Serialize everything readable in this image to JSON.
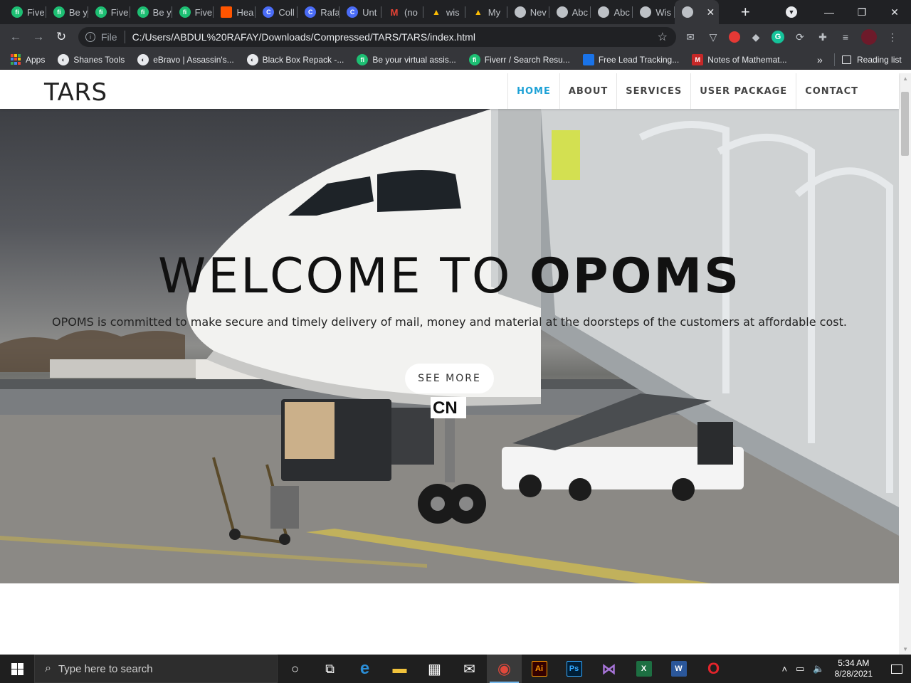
{
  "browser": {
    "tabs": [
      {
        "label": "Five",
        "icon": "fiverr-icon",
        "badge": "fi"
      },
      {
        "label": "Be y",
        "icon": "fiverr-icon",
        "badge": "fi"
      },
      {
        "label": "Five",
        "icon": "fiverr-icon",
        "badge": "fi"
      },
      {
        "label": "Be y",
        "icon": "fiverr-icon",
        "badge": "fi"
      },
      {
        "label": "Five",
        "icon": "fiverr-icon",
        "badge": "fi"
      },
      {
        "label": "Hea",
        "icon": "soundcloud-icon",
        "badge": ""
      },
      {
        "label": "Coll",
        "icon": "c-icon",
        "badge": "C"
      },
      {
        "label": "Rafa",
        "icon": "c-icon",
        "badge": "C"
      },
      {
        "label": "Unt",
        "icon": "c-icon",
        "badge": "C"
      },
      {
        "label": "(no",
        "icon": "gmail-icon",
        "badge": "M"
      },
      {
        "label": "wis",
        "icon": "drive-icon",
        "badge": "▲"
      },
      {
        "label": "My",
        "icon": "drive-icon",
        "badge": "▲"
      },
      {
        "label": "Nev",
        "icon": "chrome-icon",
        "badge": ""
      },
      {
        "label": "Abc",
        "icon": "globe-icon",
        "badge": ""
      },
      {
        "label": "Abc",
        "icon": "globe-icon",
        "badge": ""
      },
      {
        "label": "Wis",
        "icon": "globe-icon",
        "badge": ""
      }
    ],
    "active_tab_close": "✕",
    "new_tab": "+",
    "address": {
      "scheme_label": "File",
      "url": "C:/Users/ABDUL%20RAFAY/Downloads/Compressed/TARS/TARS/index.html"
    },
    "bookmarks": [
      {
        "label": "Apps",
        "icon": "apps-icon"
      },
      {
        "label": "Shanes Tools",
        "icon": "globe-icon"
      },
      {
        "label": "eBravo | Assassin's...",
        "icon": "globe-icon"
      },
      {
        "label": "Black Box Repack -...",
        "icon": "globe-icon"
      },
      {
        "label": "Be your virtual assis...",
        "icon": "fiverr-icon"
      },
      {
        "label": "Fiverr / Search Resu...",
        "icon": "fiverr-icon"
      },
      {
        "label": "Free Lead Tracking...",
        "icon": "lead-icon"
      },
      {
        "label": "Notes of Mathemat...",
        "icon": "m-icon"
      }
    ],
    "bookmarks_more": "»",
    "reading_list": "Reading list"
  },
  "site": {
    "brand": "TARS",
    "nav": [
      {
        "label": "HOME",
        "active": true
      },
      {
        "label": "ABOUT",
        "active": false
      },
      {
        "label": "SERVICES",
        "active": false
      },
      {
        "label": "USER PACKAGE",
        "active": false
      },
      {
        "label": "CONTACT",
        "active": false
      }
    ],
    "accent_color": "#1da1d6",
    "hero": {
      "title_plain": "WELCOME TO ",
      "title_bold": "OPOMS",
      "subtitle": "OPOMS is committed to make secure and timely delivery of mail, money and material at the doorsteps of the customers at affordable cost.",
      "button": "SEE MORE",
      "aircraft_code": "CN"
    }
  },
  "taskbar": {
    "search_placeholder": "Type here to search",
    "apps": [
      {
        "name": "cortana-icon",
        "glyph": "○"
      },
      {
        "name": "task-view-icon",
        "glyph": "⧉"
      },
      {
        "name": "edge-icon",
        "glyph": "e"
      },
      {
        "name": "file-explorer-icon",
        "glyph": "▬"
      },
      {
        "name": "store-icon",
        "glyph": "▦"
      },
      {
        "name": "mail-icon",
        "glyph": "✉"
      },
      {
        "name": "chrome-icon",
        "glyph": "◉"
      },
      {
        "name": "illustrator-icon",
        "glyph": "Ai"
      },
      {
        "name": "photoshop-icon",
        "glyph": "Ps"
      },
      {
        "name": "visual-studio-icon",
        "glyph": "⋈"
      },
      {
        "name": "excel-icon",
        "glyph": "X"
      },
      {
        "name": "word-icon",
        "glyph": "W"
      },
      {
        "name": "opera-icon",
        "glyph": "O"
      }
    ],
    "time": "5:34 AM",
    "date": "8/28/2021"
  }
}
